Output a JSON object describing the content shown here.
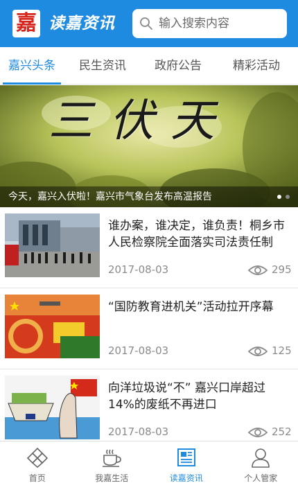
{
  "header": {
    "logo_char": "嘉",
    "brand": "读嘉资讯",
    "search_placeholder": "输入搜索内容"
  },
  "tabs": [
    {
      "label": "嘉兴头条",
      "active": true
    },
    {
      "label": "民生资讯",
      "active": false
    },
    {
      "label": "政府公告",
      "active": false
    },
    {
      "label": "精彩活动",
      "active": false
    }
  ],
  "banner": {
    "title": "三伏天",
    "caption": "今天，嘉兴入伏啦！嘉兴市气象台发布高温报告"
  },
  "news": [
    {
      "title": "谁办案，谁决定，谁负责！桐乡市人民检察院全面落实司法责任制",
      "date": "2017-08-03",
      "views": "295"
    },
    {
      "title": "“国防教育进机关”活动拉开序幕",
      "date": "2017-08-03",
      "views": "125"
    },
    {
      "title": "向洋垃圾说“不” 嘉兴口岸超过14%的废纸不再进口",
      "date": "2017-08-03",
      "views": "252"
    }
  ],
  "bottom_nav": [
    {
      "label": "首页",
      "icon": "home-diamond-icon"
    },
    {
      "label": "我嘉生活",
      "icon": "coffee-cup-icon"
    },
    {
      "label": "读嘉资讯",
      "icon": "newspaper-icon",
      "active": true
    },
    {
      "label": "个人管家",
      "icon": "user-icon"
    }
  ],
  "colors": {
    "primary": "#1f8be0",
    "logo_red": "#d7261e"
  }
}
